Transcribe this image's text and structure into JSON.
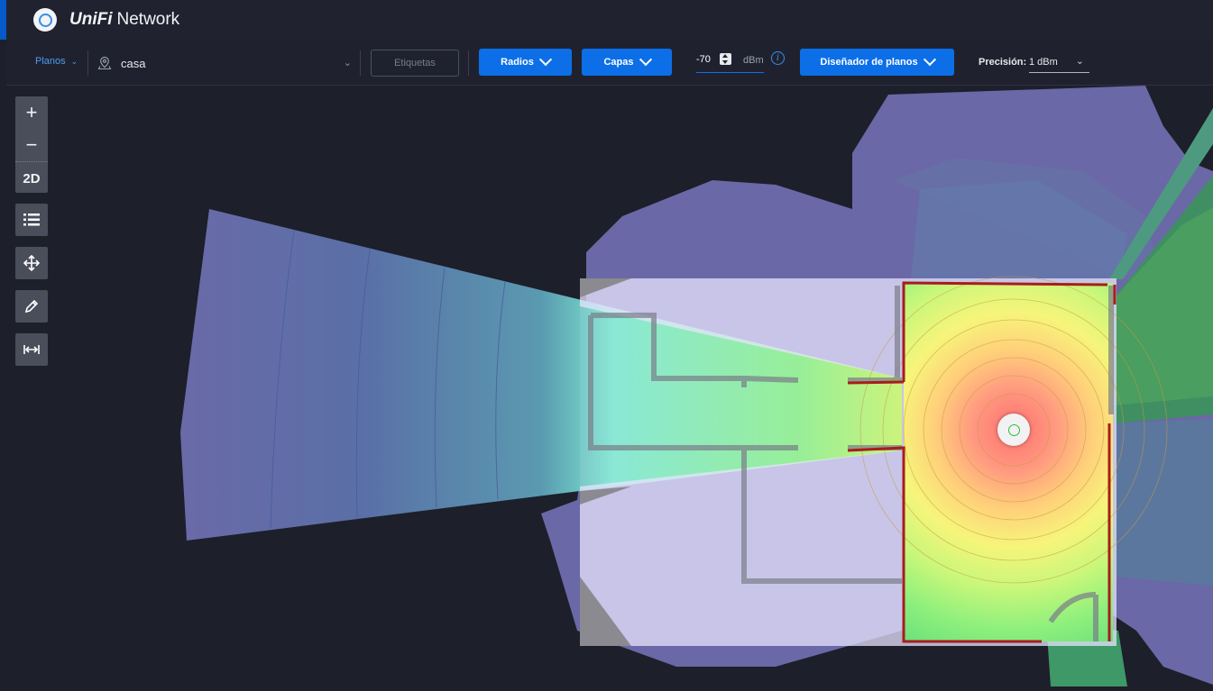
{
  "app": {
    "brand_logo": "UniFi",
    "brand_name": "Network"
  },
  "toolbar": {
    "planos_label": "Planos",
    "map_name": "casa",
    "tags_button": "Etiquetas",
    "radios_button": "Radios",
    "layers_button": "Capas",
    "signal_value": "-70",
    "signal_unit": "dBm",
    "designer_button": "Diseñador de planos",
    "precision_label": "Precisión:",
    "precision_value": "1 dBm"
  },
  "map_tools": {
    "zoom_in": "+",
    "zoom_out": "−",
    "view_mode": "2D"
  },
  "colors": {
    "accent": "#0c6fe8",
    "background": "#1d1f2a",
    "wall": "#b02020"
  }
}
